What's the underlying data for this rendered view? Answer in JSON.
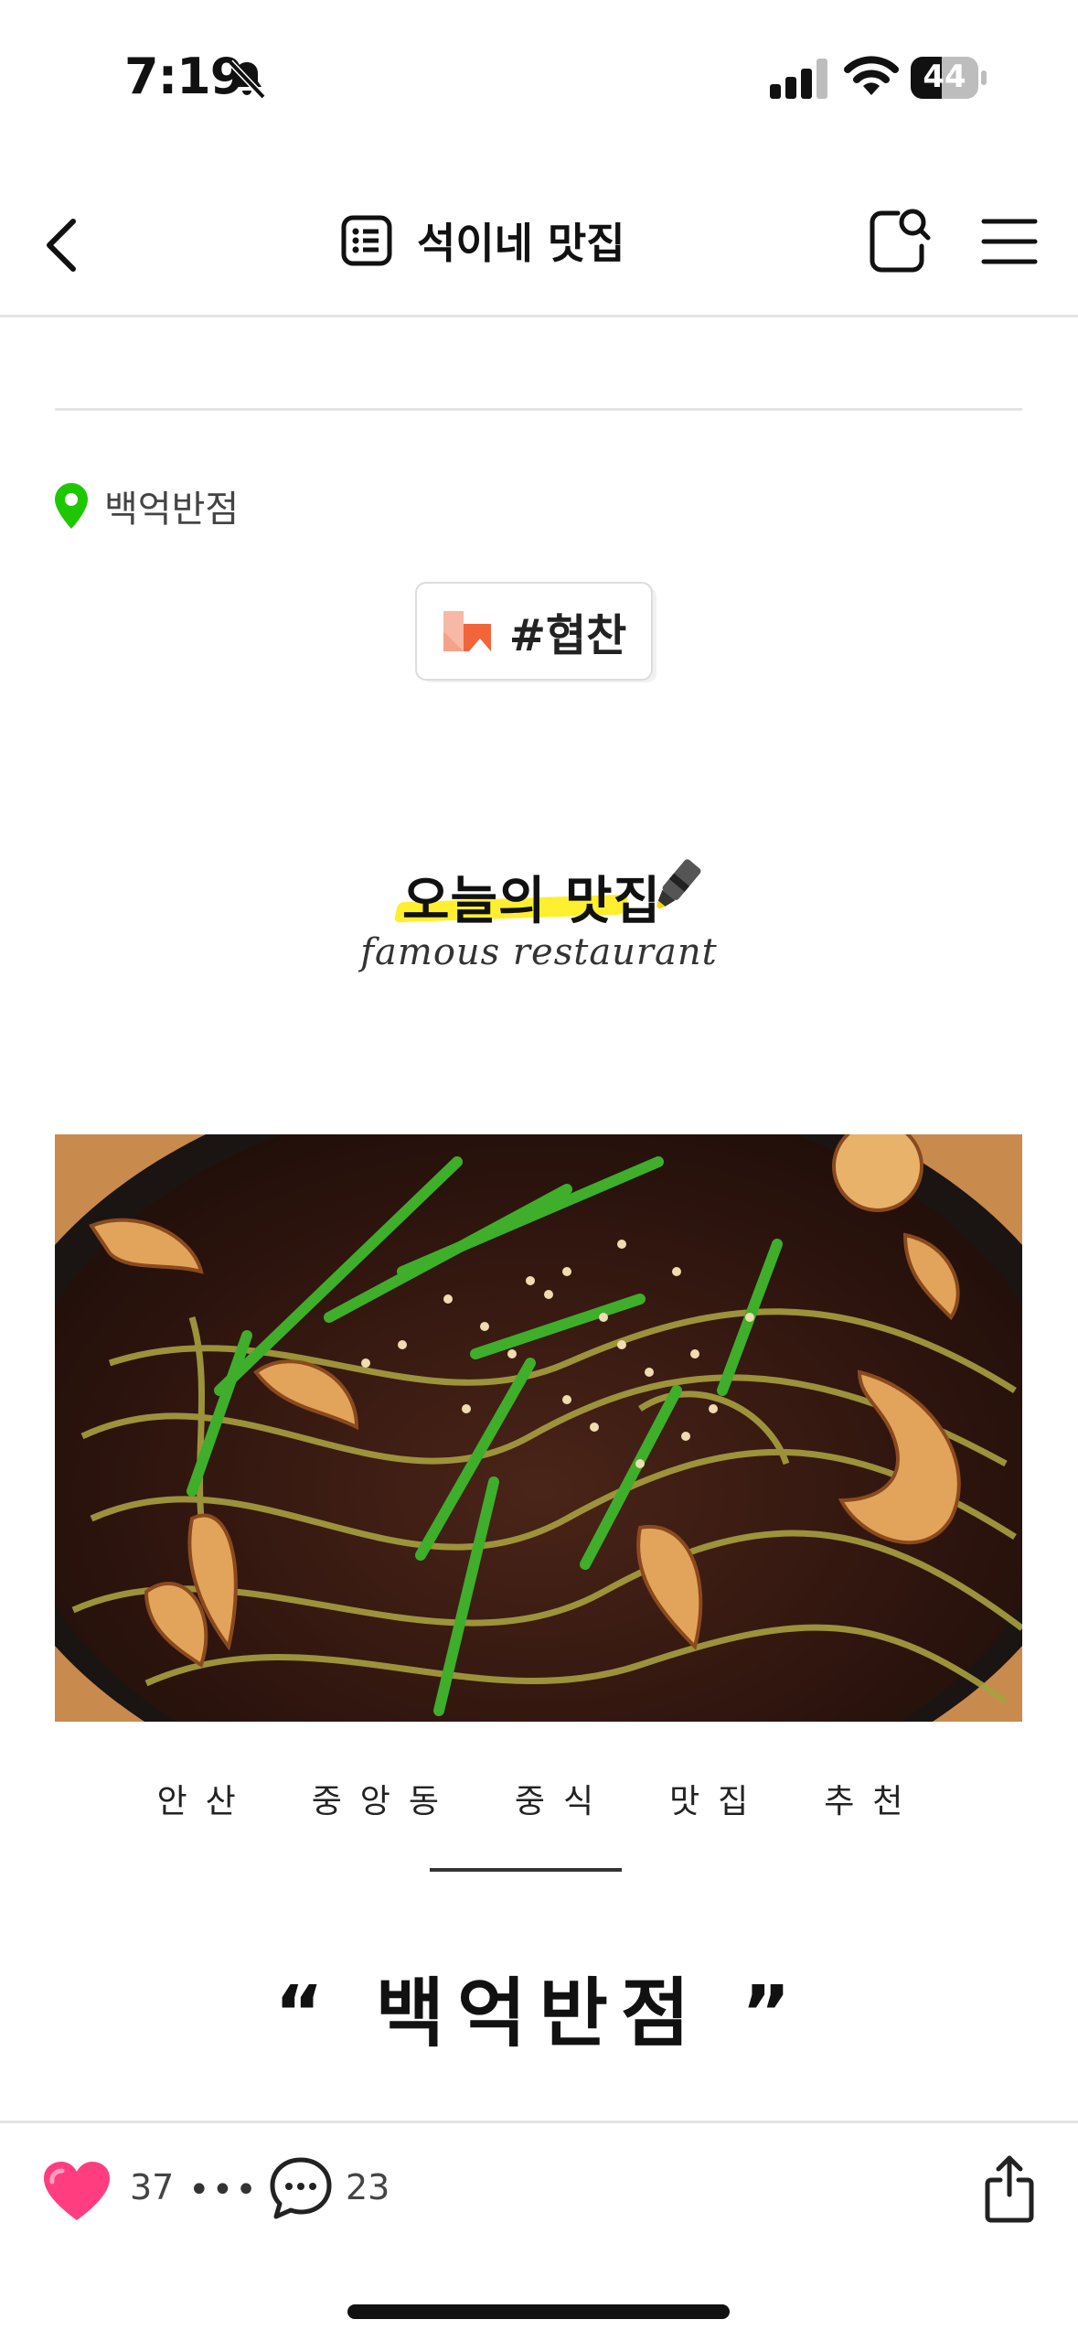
{
  "status_bar": {
    "time": "7:19",
    "battery": "44"
  },
  "nav": {
    "title": "석이네 맛집"
  },
  "post": {
    "location": "백억반점",
    "sponsor_tag": "#협찬",
    "today_title": "오늘의 맛집",
    "today_subtitle": "famous restaurant",
    "caption": "안산  중앙동  중식  맛집  추천",
    "restaurant_heading": "“ 백억반점 ”"
  },
  "bottom_bar": {
    "likes": "37",
    "more": "•••",
    "comments": "23"
  },
  "colors": {
    "accent_green": "#1ec800",
    "like_pink": "#ff3d7f",
    "highlight_yellow": "#ffef2e",
    "sponsor_orange": "#f2643a"
  }
}
